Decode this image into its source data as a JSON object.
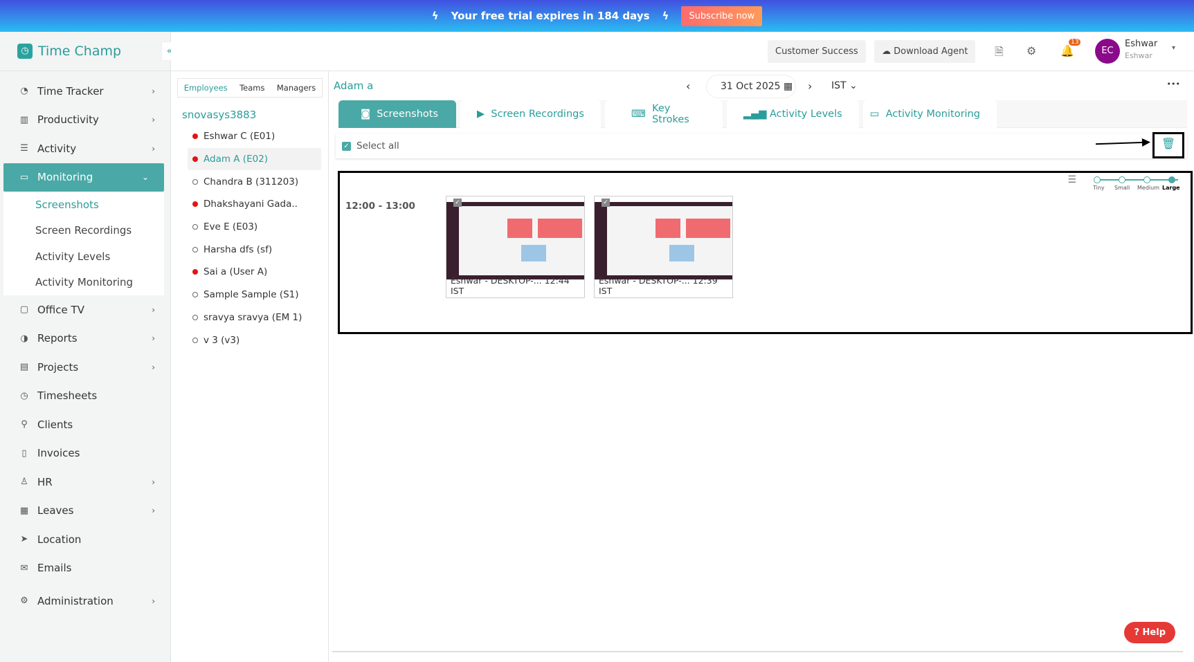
{
  "banner": {
    "text": "Your free trial expires in 184 days",
    "subscribe": "Subscribe now"
  },
  "app": {
    "name": "Time Champ",
    "collapse": "«"
  },
  "header": {
    "customer_success": "Customer Success",
    "download_agent": "Download Agent",
    "notifications": "13",
    "avatar": "EC",
    "user_name": "Eshwar",
    "user_sub": "Eshwar"
  },
  "sidebar": {
    "items": [
      {
        "label": "Time Tracker",
        "icon": "◔"
      },
      {
        "label": "Productivity",
        "icon": "▥"
      },
      {
        "label": "Activity",
        "icon": "☰"
      },
      {
        "label": "Monitoring",
        "icon": "▭"
      },
      {
        "label": "Office TV",
        "icon": "▢"
      },
      {
        "label": "Reports",
        "icon": "◑"
      },
      {
        "label": "Projects",
        "icon": "▤"
      },
      {
        "label": "Timesheets",
        "icon": "◷"
      },
      {
        "label": "Clients",
        "icon": "⚲"
      },
      {
        "label": "Invoices",
        "icon": "▯"
      },
      {
        "label": "HR",
        "icon": "♙"
      },
      {
        "label": "Leaves",
        "icon": "▦"
      },
      {
        "label": "Location",
        "icon": "➤"
      },
      {
        "label": "Emails",
        "icon": "✉"
      },
      {
        "label": "Administration",
        "icon": "⚙"
      }
    ],
    "monitoring_sub": [
      "Screenshots",
      "Screen Recordings",
      "Activity Levels",
      "Activity Monitoring"
    ]
  },
  "employees": {
    "tabs": [
      "Employees",
      "Teams",
      "Managers"
    ],
    "org": "snovasys3883",
    "list": [
      {
        "name": "Eshwar C (E01)",
        "online": true
      },
      {
        "name": "Adam A (E02)",
        "online": true
      },
      {
        "name": "Chandra B (311203)",
        "online": false
      },
      {
        "name": "Dhakshayani Gada..",
        "online": true
      },
      {
        "name": "Eve E (E03)",
        "online": false
      },
      {
        "name": "Harsha dfs (sf)",
        "online": false
      },
      {
        "name": "Sai a (User A)",
        "online": true
      },
      {
        "name": "Sample Sample (S1)",
        "online": false
      },
      {
        "name": "sravya sravya (EM 1)",
        "online": false
      },
      {
        "name": "v 3 (v3)",
        "online": false
      }
    ]
  },
  "main": {
    "title": "Adam a",
    "date": "31 Oct 2025",
    "timezone": "IST",
    "more": "•••",
    "tabs": [
      "Screenshots",
      "Screen Recordings",
      "Key Strokes",
      "Activity Levels",
      "Activity Monitoring"
    ],
    "select_all": "Select all",
    "time_range": "12:00 - 13:00",
    "sizes": [
      "Tiny",
      "Small",
      "Medium",
      "Large"
    ],
    "selected_size": "Large",
    "screenshots": [
      {
        "caption": "Eshwar - DESKTOP-... 12:44 IST"
      },
      {
        "caption": "Eshwar - DESKTOP-... 12:39 IST"
      }
    ]
  },
  "help": "? Help"
}
